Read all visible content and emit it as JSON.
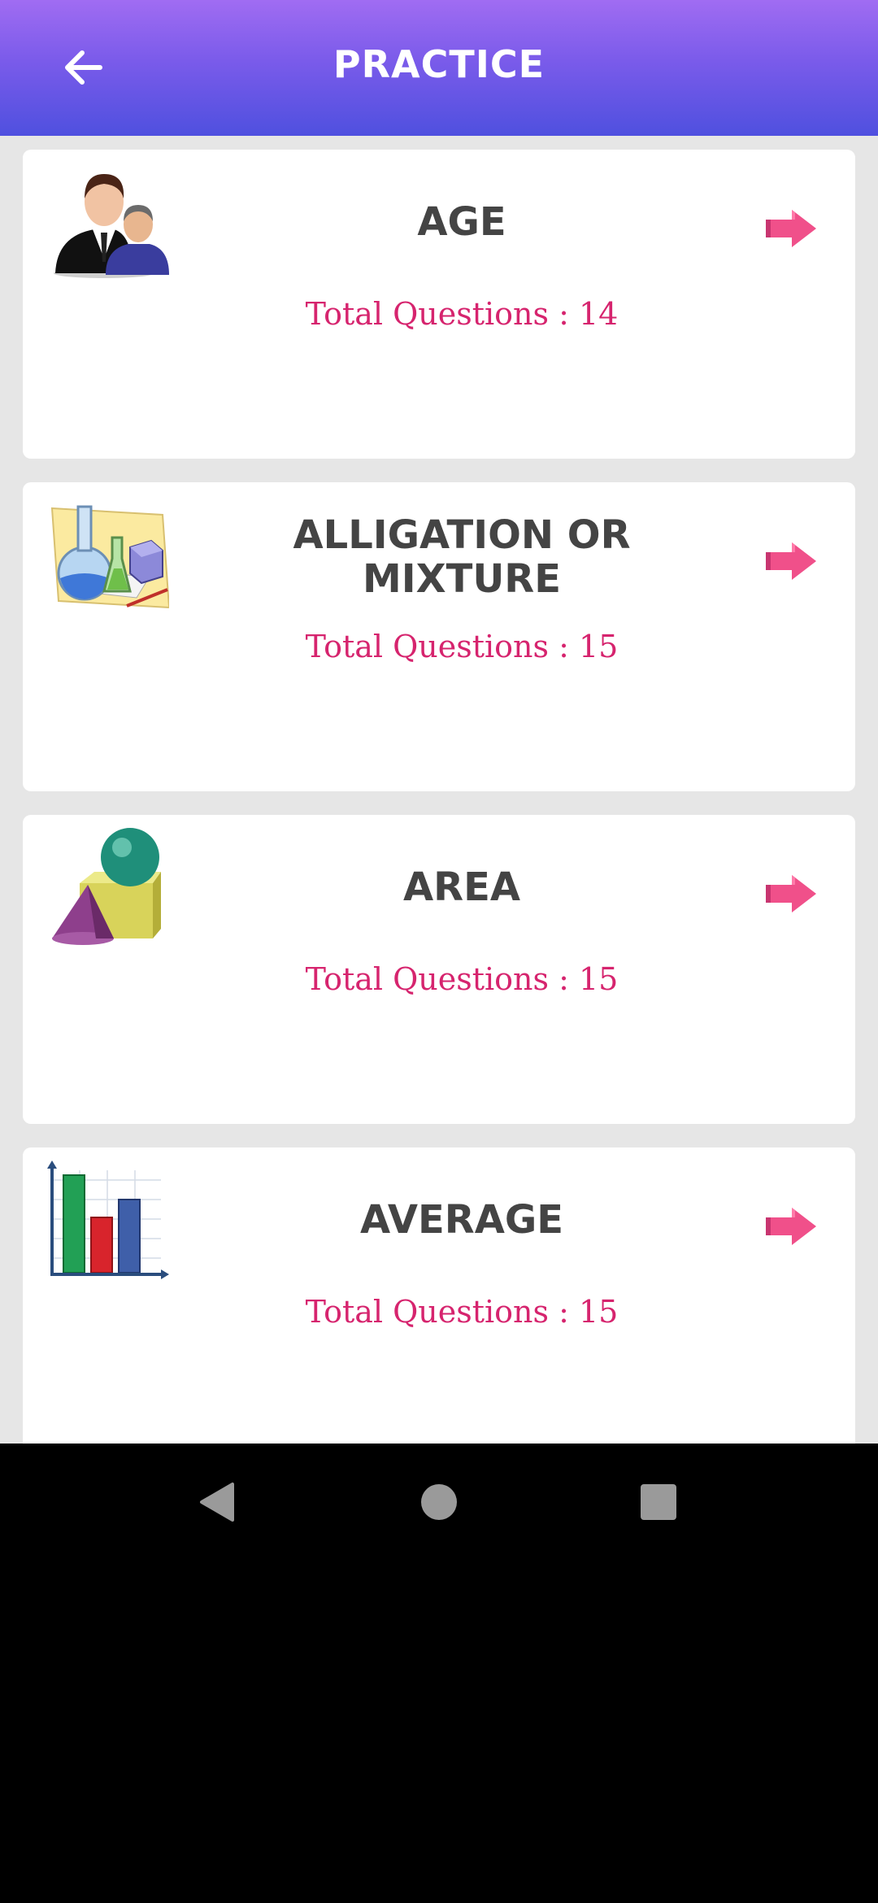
{
  "header": {
    "title": "PRACTICE",
    "back_icon": "arrow-left-icon"
  },
  "colors": {
    "header_gradient_top": "#a06cf2",
    "header_gradient_bottom": "#4f50df",
    "subtitle": "#d6246e",
    "title": "#444444",
    "arrow": "#f0508a",
    "background": "#e6e6e6"
  },
  "topics": [
    {
      "title": "AGE",
      "subtitle": "Total Questions : 14",
      "icon": "people-icon"
    },
    {
      "title": "ALLIGATION OR\nMIXTURE",
      "subtitle": "Total Questions : 15",
      "icon": "lab-flask-icon"
    },
    {
      "title": "AREA",
      "subtitle": "Total Questions : 15",
      "icon": "geometric-shapes-icon"
    },
    {
      "title": "AVERAGE",
      "subtitle": "Total Questions : 15",
      "icon": "bar-chart-icon"
    }
  ],
  "system_nav": {
    "back": "nav-back-icon",
    "home": "nav-home-icon",
    "recents": "nav-recents-icon"
  }
}
